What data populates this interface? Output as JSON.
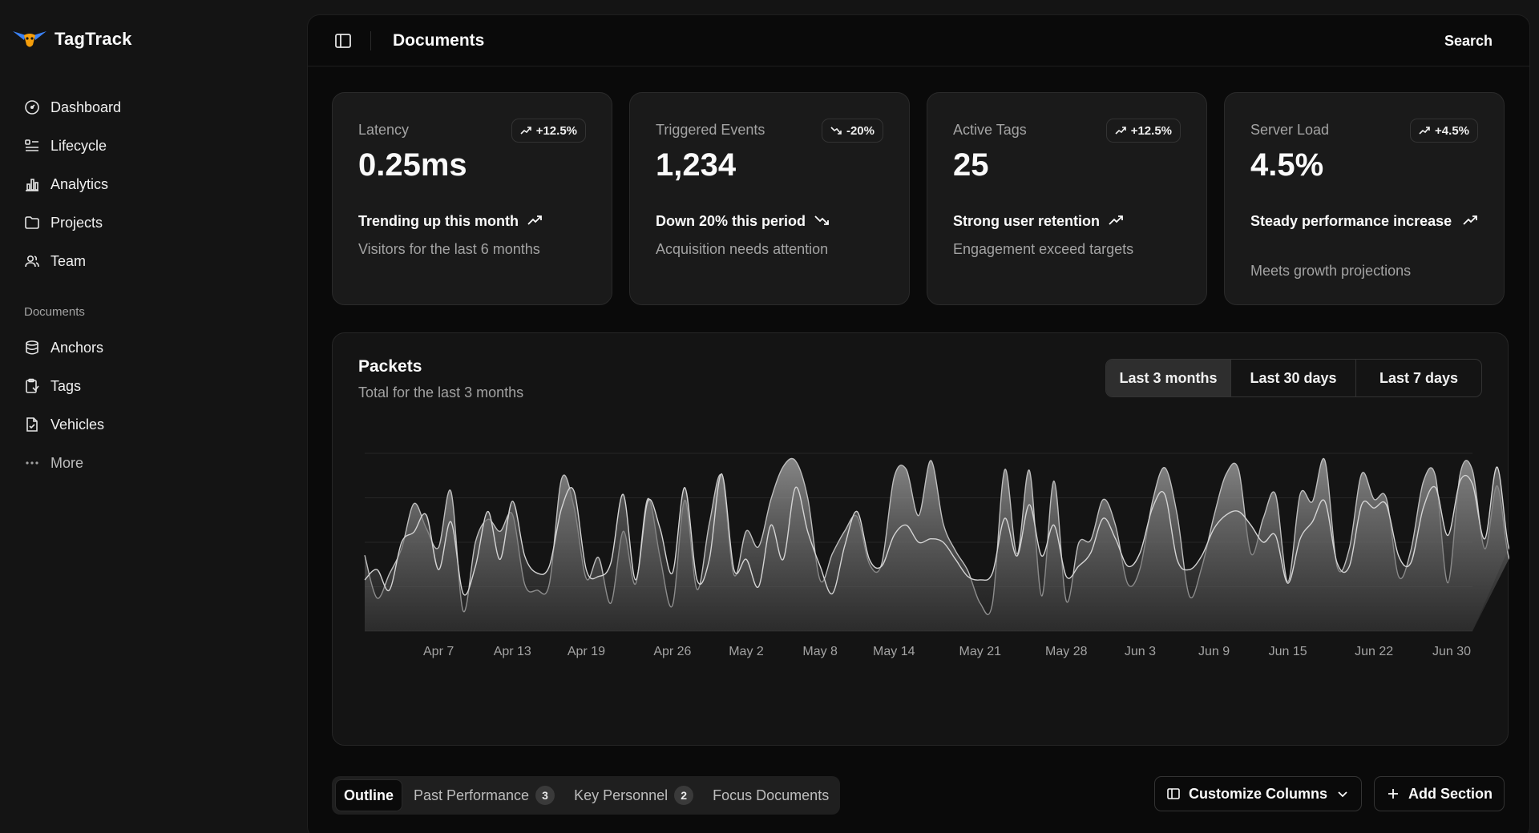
{
  "brand": {
    "name": "TagTrack"
  },
  "sidebar": {
    "items": [
      {
        "label": "Dashboard",
        "icon": "gauge-icon"
      },
      {
        "label": "Lifecycle",
        "icon": "list-icon"
      },
      {
        "label": "Analytics",
        "icon": "bar-chart-icon"
      },
      {
        "label": "Projects",
        "icon": "folder-icon"
      },
      {
        "label": "Team",
        "icon": "users-icon"
      }
    ],
    "section_label": "Documents",
    "documents": [
      {
        "label": "Anchors",
        "icon": "database-icon"
      },
      {
        "label": "Tags",
        "icon": "clipboard-icon"
      },
      {
        "label": "Vehicles",
        "icon": "file-icon"
      },
      {
        "label": "More",
        "icon": "dots-icon"
      }
    ]
  },
  "header": {
    "title": "Documents",
    "search_label": "Search"
  },
  "cards": [
    {
      "label": "Latency",
      "value": "0.25ms",
      "badge": "+12.5%",
      "trend": "up",
      "footer": "Trending up this month",
      "sub": "Visitors for the last 6 months"
    },
    {
      "label": "Triggered Events",
      "value": "1,234",
      "badge": "-20%",
      "trend": "down",
      "footer": "Down 20% this period",
      "sub": "Acquisition needs attention"
    },
    {
      "label": "Active Tags",
      "value": "25",
      "badge": "+12.5%",
      "trend": "up",
      "footer": "Strong user retention",
      "sub": "Engagement exceed targets"
    },
    {
      "label": "Server Load",
      "value": "4.5%",
      "badge": "+4.5%",
      "trend": "up",
      "footer": "Steady performance increase",
      "sub": "Meets growth projections"
    }
  ],
  "chart": {
    "title": "Packets",
    "subtitle": "Total for the last 3 months",
    "ranges": [
      "Last 3 months",
      "Last 30 days",
      "Last 7 days"
    ],
    "active_range": "Last 3 months"
  },
  "chart_data": {
    "type": "area",
    "title": "Packets",
    "subtitle": "Total for the last 3 months",
    "x": [
      "Apr 1",
      "Apr 2",
      "Apr 3",
      "Apr 4",
      "Apr 5",
      "Apr 6",
      "Apr 7",
      "Apr 8",
      "Apr 9",
      "Apr 10",
      "Apr 11",
      "Apr 12",
      "Apr 13",
      "Apr 14",
      "Apr 15",
      "Apr 16",
      "Apr 17",
      "Apr 18",
      "Apr 19",
      "Apr 20",
      "Apr 21",
      "Apr 22",
      "Apr 23",
      "Apr 24",
      "Apr 25",
      "Apr 26",
      "Apr 27",
      "Apr 28",
      "Apr 29",
      "Apr 30",
      "May 1",
      "May 2",
      "May 3",
      "May 4",
      "May 5",
      "May 6",
      "May 7",
      "May 8",
      "May 9",
      "May 10",
      "May 11",
      "May 12",
      "May 13",
      "May 14",
      "May 15",
      "May 16",
      "May 17",
      "May 18",
      "May 19",
      "May 20",
      "May 21",
      "May 22",
      "May 23",
      "May 24",
      "May 25",
      "May 26",
      "May 27",
      "May 28",
      "May 29",
      "May 30",
      "May 31",
      "Jun 1",
      "Jun 2",
      "Jun 3",
      "Jun 4",
      "Jun 5",
      "Jun 6",
      "Jun 7",
      "Jun 8",
      "Jun 9",
      "Jun 10",
      "Jun 11",
      "Jun 12",
      "Jun 13",
      "Jun 14",
      "Jun 15",
      "Jun 16",
      "Jun 17",
      "Jun 18",
      "Jun 19",
      "Jun 20",
      "Jun 21",
      "Jun 22",
      "Jun 23",
      "Jun 24",
      "Jun 25",
      "Jun 26",
      "Jun 27",
      "Jun 28",
      "Jun 29",
      "Jun 30"
    ],
    "x_ticks": [
      "Apr 7",
      "Apr 13",
      "Apr 19",
      "Apr 26",
      "May 2",
      "May 8",
      "May 14",
      "May 21",
      "May 28",
      "Jun 3",
      "Jun 9",
      "Jun 15",
      "Jun 22",
      "Jun 30"
    ],
    "series": [
      {
        "values": [
          222,
          97,
          167,
          242,
          373,
          301,
          245,
          409,
          59,
          261,
          327,
          292,
          342,
          137,
          120,
          138,
          446,
          364,
          154,
          215,
          82,
          292,
          138,
          387,
          215,
          75,
          383,
          122,
          315,
          454,
          165,
          293,
          247,
          385,
          481,
          498,
          388,
          149,
          227,
          293,
          335,
          197,
          197,
          448,
          473,
          338,
          499,
          315,
          235,
          177,
          82,
          81,
          472,
          226,
          470,
          103,
          439,
          88,
          257,
          267,
          385,
          309,
          138,
          184,
          379,
          478,
          342,
          103,
          186,
          337,
          460,
          472,
          227,
          330,
          400,
          145,
          400,
          379,
          500,
          190,
          242,
          460,
          386,
          389,
          160,
          237,
          436,
          452,
          141,
          460,
          470,
          241,
          425,
          212,
          285
        ]
      },
      {
        "values": [
          150,
          180,
          120,
          260,
          290,
          340,
          180,
          320,
          110,
          190,
          350,
          210,
          380,
          220,
          170,
          190,
          360,
          410,
          180,
          160,
          200,
          400,
          150,
          380,
          300,
          170,
          420,
          150,
          210,
          460,
          180,
          210,
          130,
          310,
          210,
          420,
          290,
          190,
          110,
          250,
          350,
          210,
          190,
          280,
          310,
          260,
          270,
          260,
          210,
          160,
          150,
          170,
          330,
          220,
          370,
          220,
          310,
          160,
          190,
          230,
          330,
          270,
          190,
          230,
          360,
          400,
          210,
          180,
          220,
          300,
          340,
          350,
          310,
          260,
          280,
          140,
          270,
          320,
          380,
          200,
          190,
          370,
          360,
          370,
          220,
          200,
          360,
          420,
          280,
          440,
          430,
          270,
          480,
          240,
          330
        ]
      }
    ],
    "ylim": [
      0,
      520
    ],
    "grid": true,
    "legend": "none"
  },
  "bottom": {
    "tabs": [
      {
        "label": "Outline",
        "count": null,
        "active": true
      },
      {
        "label": "Past Performance",
        "count": "3",
        "active": false
      },
      {
        "label": "Key Personnel",
        "count": "2",
        "active": false
      },
      {
        "label": "Focus Documents",
        "count": null,
        "active": false
      }
    ],
    "customize_label": "Customize Columns",
    "add_label": "Add Section"
  }
}
